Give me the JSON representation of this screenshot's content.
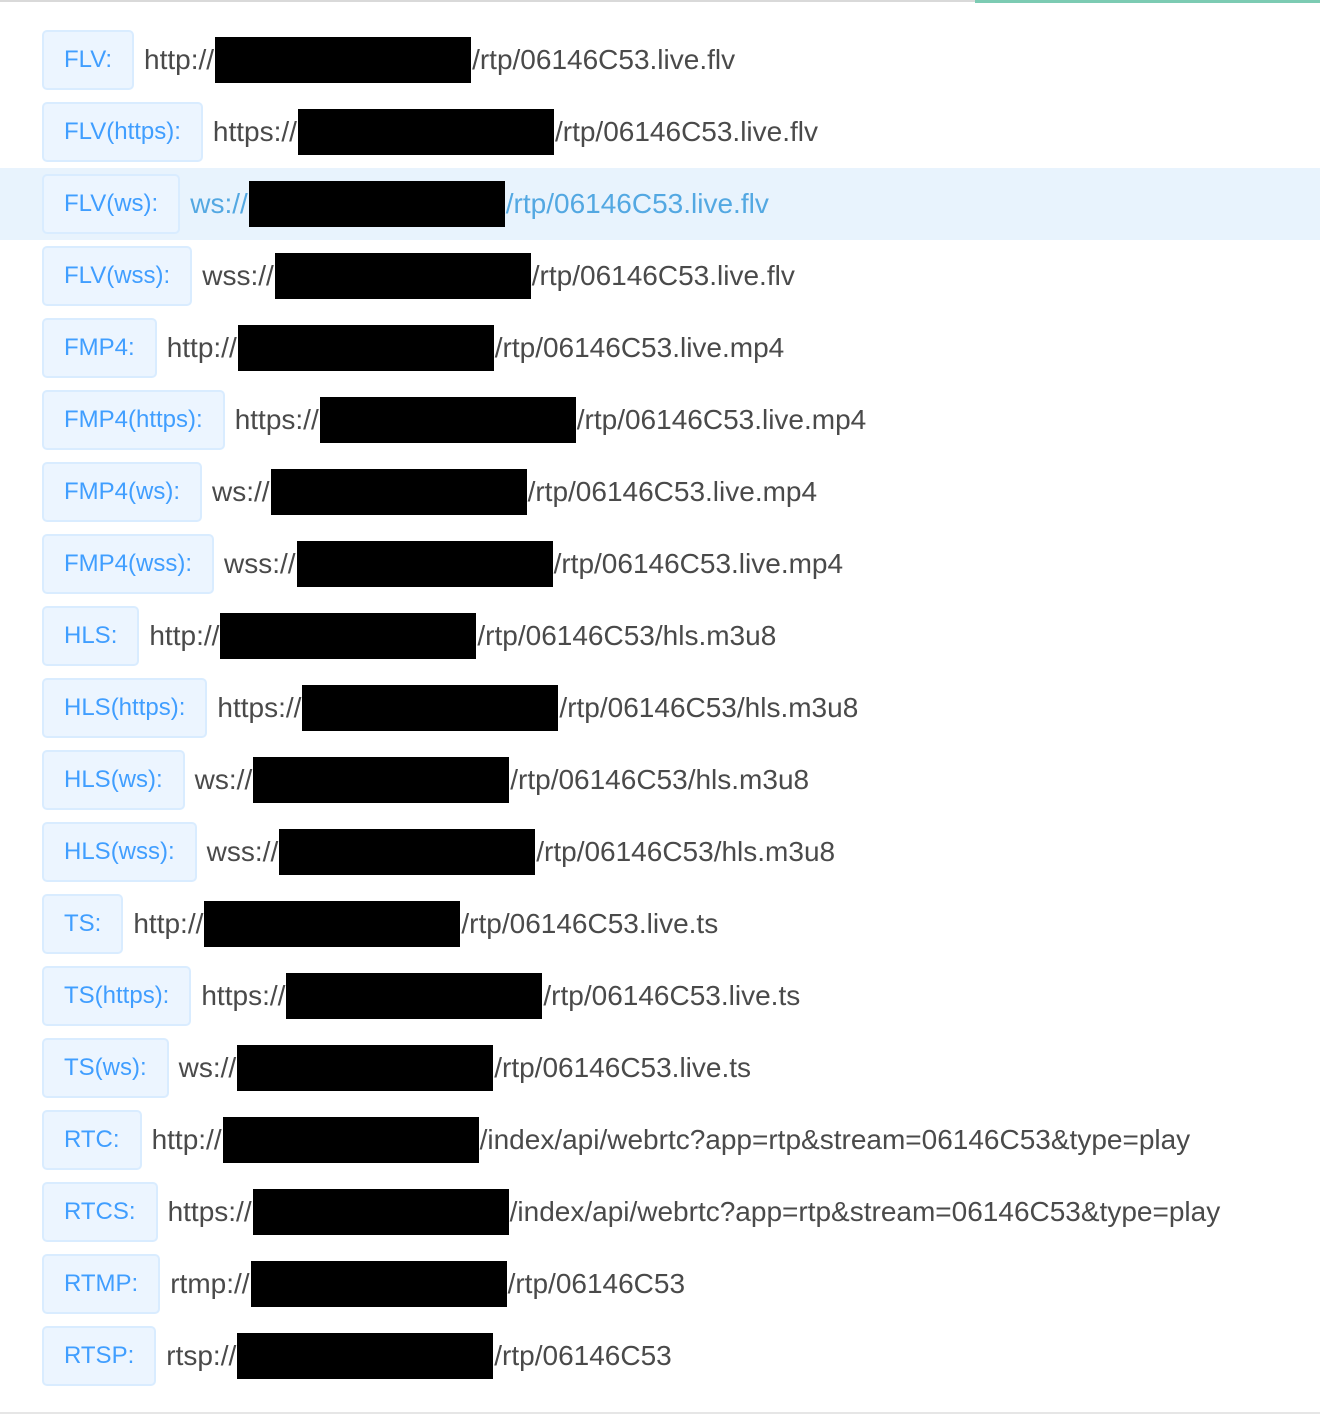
{
  "colors": {
    "tag_text": "#409eff",
    "tag_background": "#ecf5ff",
    "tag_border": "#d9ecff",
    "highlight_row": "#e8f3fd",
    "highlight_text": "#53a8e2",
    "url_text": "#4a4a4a",
    "redaction": "#000000"
  },
  "streams": [
    {
      "label": "FLV:",
      "scheme": "http://",
      "path": "/rtp/06146C53.live.flv"
    },
    {
      "label": "FLV(https):",
      "scheme": "https://",
      "path": "/rtp/06146C53.live.flv"
    },
    {
      "label": "FLV(ws):",
      "scheme": "ws://",
      "path": "/rtp/06146C53.live.flv",
      "highlighted": true
    },
    {
      "label": "FLV(wss):",
      "scheme": "wss://",
      "path": "/rtp/06146C53.live.flv"
    },
    {
      "label": "FMP4:",
      "scheme": "http://",
      "path": "/rtp/06146C53.live.mp4"
    },
    {
      "label": "FMP4(https):",
      "scheme": "https://",
      "path": "/rtp/06146C53.live.mp4"
    },
    {
      "label": "FMP4(ws):",
      "scheme": "ws://",
      "path": "/rtp/06146C53.live.mp4"
    },
    {
      "label": "FMP4(wss):",
      "scheme": "wss://",
      "path": "/rtp/06146C53.live.mp4"
    },
    {
      "label": "HLS:",
      "scheme": "http://",
      "path": "/rtp/06146C53/hls.m3u8"
    },
    {
      "label": "HLS(https):",
      "scheme": "https://",
      "path": "/rtp/06146C53/hls.m3u8"
    },
    {
      "label": "HLS(ws):",
      "scheme": "ws://",
      "path": "/rtp/06146C53/hls.m3u8"
    },
    {
      "label": "HLS(wss):",
      "scheme": "wss://",
      "path": "/rtp/06146C53/hls.m3u8"
    },
    {
      "label": "TS:",
      "scheme": "http://",
      "path": "/rtp/06146C53.live.ts"
    },
    {
      "label": "TS(https):",
      "scheme": "https://",
      "path": "/rtp/06146C53.live.ts"
    },
    {
      "label": "TS(ws):",
      "scheme": "ws://",
      "path": "/rtp/06146C53.live.ts"
    },
    {
      "label": "RTC:",
      "scheme": "http://",
      "path": "/index/api/webrtc?app=rtp&stream=06146C53&type=play"
    },
    {
      "label": "RTCS:",
      "scheme": "https://",
      "path": "/index/api/webrtc?app=rtp&stream=06146C53&type=play"
    },
    {
      "label": "RTMP:",
      "scheme": "rtmp://",
      "path": "/rtp/06146C53"
    },
    {
      "label": "RTSP:",
      "scheme": "rtsp://",
      "path": "/rtp/06146C53"
    }
  ]
}
